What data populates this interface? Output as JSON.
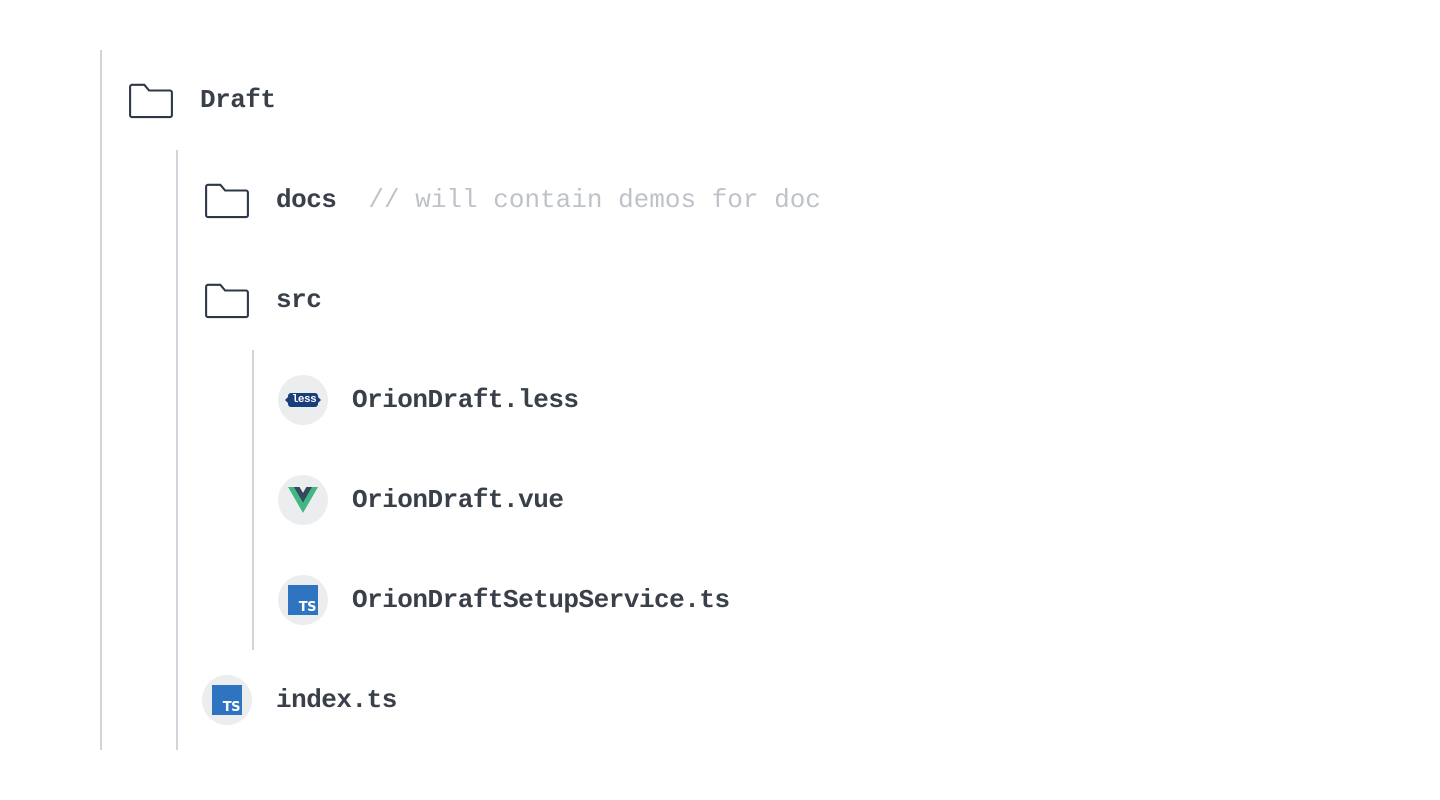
{
  "tree": {
    "root": {
      "label": "Draft",
      "children": {
        "docs": {
          "label": "docs",
          "comment": "// will contain demos for doc"
        },
        "src": {
          "label": "src",
          "files": [
            {
              "name": "OrionDraft.less",
              "icon": "less"
            },
            {
              "name": "OrionDraft.vue",
              "icon": "vue"
            },
            {
              "name": "OrionDraftSetupService.ts",
              "icon": "ts"
            }
          ]
        },
        "index": {
          "name": "index.ts",
          "icon": "ts"
        }
      }
    }
  },
  "icon_text": {
    "less": "less",
    "ts": "TS"
  }
}
